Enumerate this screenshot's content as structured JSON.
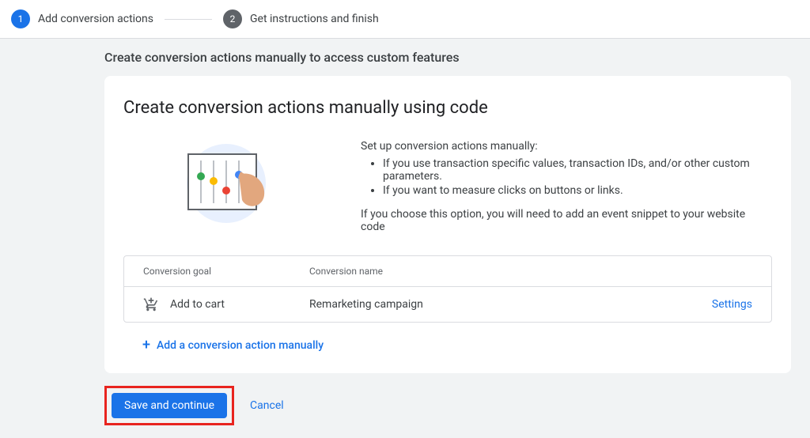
{
  "stepper": {
    "steps": [
      {
        "num": "1",
        "label": "Add conversion actions"
      },
      {
        "num": "2",
        "label": "Get instructions and finish"
      }
    ]
  },
  "heading": "Create conversion actions manually to access custom features",
  "card": {
    "title": "Create conversion actions manually using code",
    "intro_line": "Set up conversion actions manually:",
    "bullets": [
      "If you use transaction specific values, transaction IDs, and/or other custom parameters.",
      "If you want to measure clicks on buttons or links."
    ],
    "after_bullets": "If you choose this option, you will need to add an event snippet to your website code"
  },
  "table": {
    "headers": {
      "goal": "Conversion goal",
      "name": "Conversion name"
    },
    "row": {
      "goal": "Add to cart",
      "name": "Remarketing campaign",
      "settings": "Settings"
    }
  },
  "add_link": "Add a conversion action manually",
  "footer": {
    "save": "Save and continue",
    "cancel": "Cancel"
  }
}
